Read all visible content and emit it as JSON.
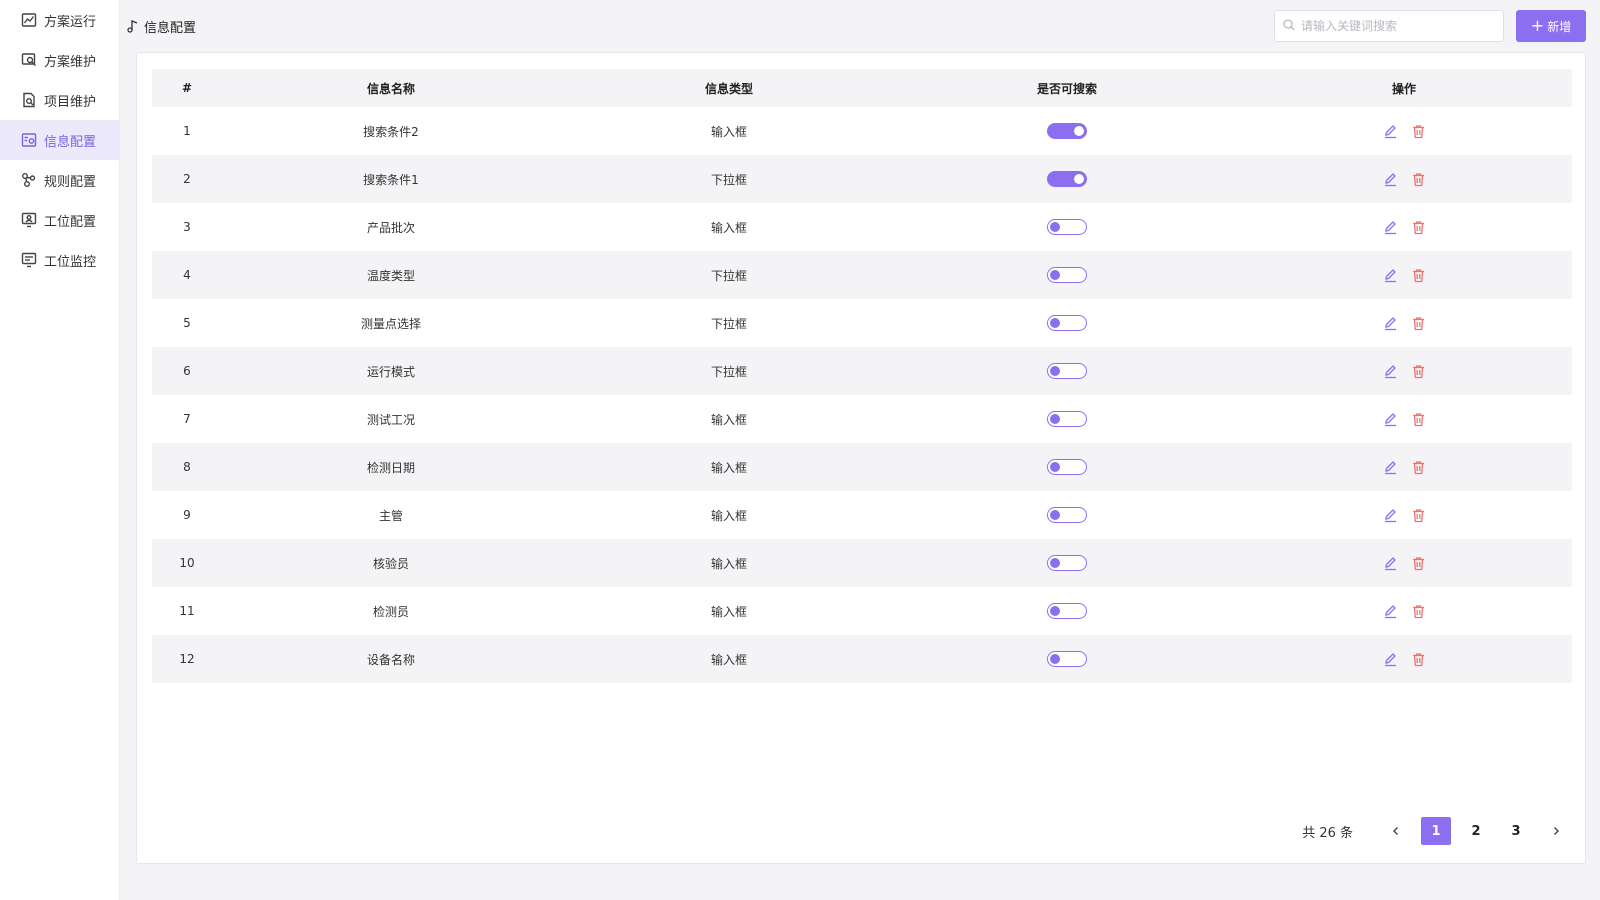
{
  "sidebar": {
    "items": [
      {
        "label": "方案运行",
        "icon": "line-chart-icon",
        "active": false
      },
      {
        "label": "方案维护",
        "icon": "monitor-search-icon",
        "active": false
      },
      {
        "label": "项目维护",
        "icon": "document-search-icon",
        "active": false
      },
      {
        "label": "信息配置",
        "icon": "settings-panel-icon",
        "active": true
      },
      {
        "label": "规则配置",
        "icon": "nodes-icon",
        "active": false
      },
      {
        "label": "工位配置",
        "icon": "monitor-user-icon",
        "active": false
      },
      {
        "label": "工位监控",
        "icon": "monitor-list-icon",
        "active": false
      }
    ]
  },
  "header": {
    "breadcrumb": "信息配置",
    "search_placeholder": "请输入关键词搜索",
    "add_label": "新增"
  },
  "table": {
    "columns": [
      "#",
      "信息名称",
      "信息类型",
      "是否可搜索",
      "操作"
    ],
    "rows": [
      {
        "index": "1",
        "name": "搜索条件2",
        "type": "输入框",
        "searchable": true
      },
      {
        "index": "2",
        "name": "搜索条件1",
        "type": "下拉框",
        "searchable": true
      },
      {
        "index": "3",
        "name": "产品批次",
        "type": "输入框",
        "searchable": false
      },
      {
        "index": "4",
        "name": "温度类型",
        "type": "下拉框",
        "searchable": false
      },
      {
        "index": "5",
        "name": "测量点选择",
        "type": "下拉框",
        "searchable": false
      },
      {
        "index": "6",
        "name": "运行模式",
        "type": "下拉框",
        "searchable": false
      },
      {
        "index": "7",
        "name": "测试工况",
        "type": "输入框",
        "searchable": false
      },
      {
        "index": "8",
        "name": "检测日期",
        "type": "输入框",
        "searchable": false
      },
      {
        "index": "9",
        "name": "主管",
        "type": "输入框",
        "searchable": false
      },
      {
        "index": "10",
        "name": "核验员",
        "type": "输入框",
        "searchable": false
      },
      {
        "index": "11",
        "name": "检测员",
        "type": "输入框",
        "searchable": false
      },
      {
        "index": "12",
        "name": "设备名称",
        "type": "输入框",
        "searchable": false
      }
    ]
  },
  "pagination": {
    "total_text": "共 26 条",
    "pages": [
      "1",
      "2",
      "3"
    ],
    "current": "1",
    "prev_icon": "chevron-left-icon",
    "next_icon": "chevron-right-icon"
  },
  "colors": {
    "accent": "#8c6ff0",
    "delete": "#f07070",
    "edit": "#8c6ff0"
  }
}
